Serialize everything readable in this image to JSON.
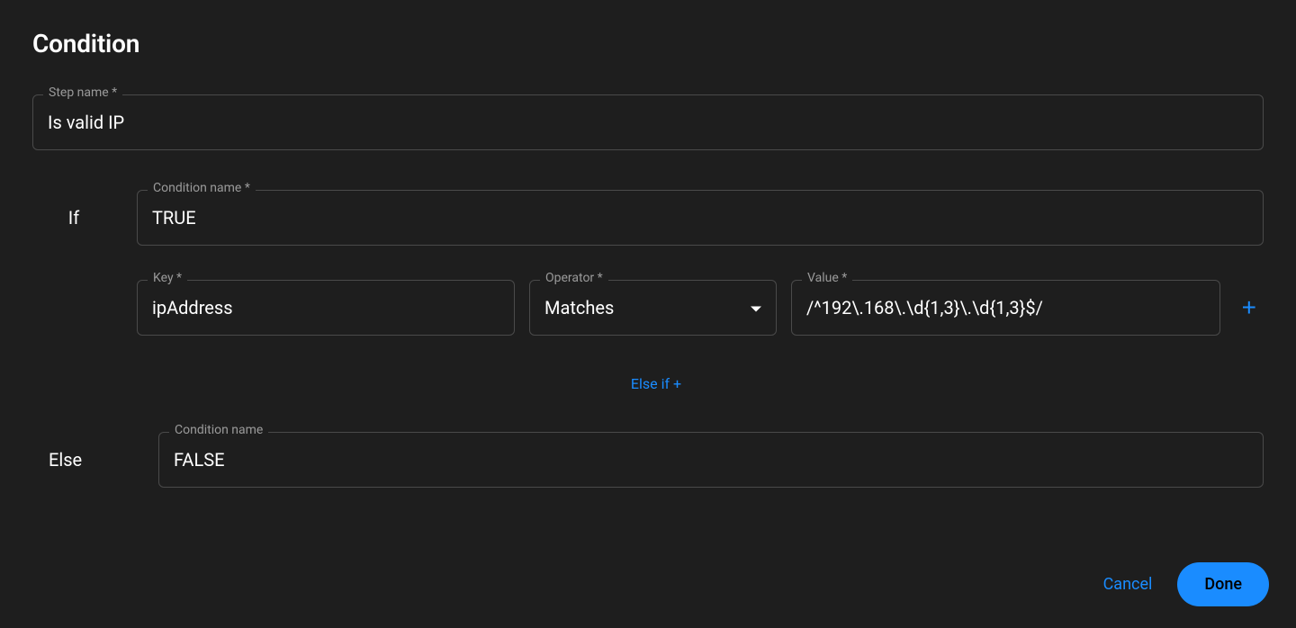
{
  "title": "Condition",
  "stepName": {
    "label": "Step name *",
    "value": "Is valid IP"
  },
  "ifSection": {
    "label": "If",
    "conditionName": {
      "label": "Condition name *",
      "value": "TRUE"
    },
    "rule": {
      "key": {
        "label": "Key *",
        "value": "ipAddress"
      },
      "operator": {
        "label": "Operator *",
        "value": "Matches"
      },
      "value": {
        "label": "Value *",
        "value": "/^192\\.168\\.\\d{1,3}\\.\\d{1,3}$/"
      }
    }
  },
  "elseIfLink": "Else if +",
  "elseSection": {
    "label": "Else",
    "conditionName": {
      "label": "Condition name",
      "value": "FALSE"
    }
  },
  "footer": {
    "cancel": "Cancel",
    "done": "Done"
  },
  "icons": {
    "add": "+"
  }
}
